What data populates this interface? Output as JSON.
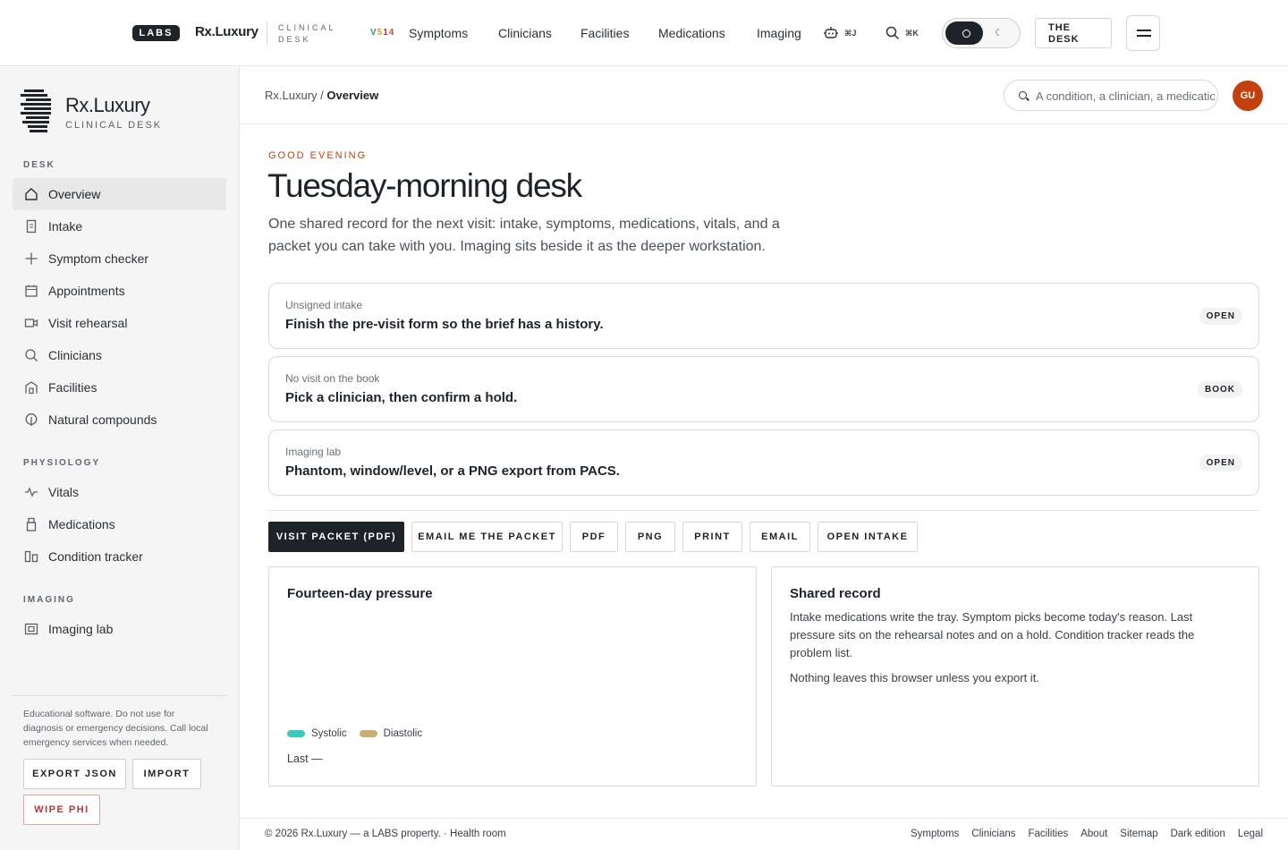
{
  "topbar": {
    "labs_badge": "LABS",
    "brand": "Rx.Luxury",
    "clinical_desk": "CLINICAL DESK",
    "version": {
      "v": "V",
      "d1": "5",
      "d2": "1",
      "d3": "4"
    },
    "nav": [
      "Symptoms",
      "Clinicians",
      "Facilities",
      "Medications",
      "Imaging"
    ],
    "assistant_shortcut": "⌘J",
    "search_shortcut": "⌘K",
    "desk_button": "THE DESK",
    "theme_mode": "light"
  },
  "sidebar": {
    "brand": "Rx.Luxury",
    "subtitle": "CLINICAL DESK",
    "sections": {
      "desk": "DESK",
      "physiology": "PHYSIOLOGY",
      "imaging": "IMAGING"
    },
    "desk_items": [
      {
        "label": "Overview",
        "icon": "home-icon"
      },
      {
        "label": "Intake",
        "icon": "document-icon"
      },
      {
        "label": "Symptom checker",
        "icon": "plus-icon"
      },
      {
        "label": "Appointments",
        "icon": "calendar-icon"
      },
      {
        "label": "Visit rehearsal",
        "icon": "video-icon"
      },
      {
        "label": "Clinicians",
        "icon": "search-icon"
      },
      {
        "label": "Facilities",
        "icon": "building-icon"
      },
      {
        "label": "Natural compounds",
        "icon": "leaf-icon"
      }
    ],
    "physiology_items": [
      {
        "label": "Vitals",
        "icon": "pulse-icon"
      },
      {
        "label": "Medications",
        "icon": "bottle-icon"
      },
      {
        "label": "Condition tracker",
        "icon": "columns-icon"
      }
    ],
    "imaging_items": [
      {
        "label": "Imaging lab",
        "icon": "image-icon"
      }
    ],
    "disclaimer": "Educational software. Do not use for diagnosis or emergency decisions. Call local emergency services when needed.",
    "export": "EXPORT JSON",
    "import": "IMPORT",
    "wipe": "WIPE PHI"
  },
  "header": {
    "crumb_root": "Rx.Luxury",
    "crumb_sep": "/",
    "crumb_current": "Overview",
    "search_placeholder": "A condition, a clinician, a medication",
    "avatar": "GU"
  },
  "main": {
    "greeting": "GOOD EVENING",
    "title": "Tuesday-morning desk",
    "lede": "One shared record for the next visit: intake, symptoms, medications, vitals, and a packet you can take with you. Imaging sits beside it as the deeper workstation.",
    "cards": [
      {
        "kicker": "Unsigned intake",
        "text": "Finish the pre-visit form so the brief has a history.",
        "badge": "OPEN"
      },
      {
        "kicker": "No visit on the book",
        "text": "Pick a clinician, then confirm a hold.",
        "badge": "BOOK"
      },
      {
        "kicker": "Imaging lab",
        "text": "Phantom, window/level, or a PNG export from PACS.",
        "badge": "OPEN"
      }
    ],
    "actions": [
      "VISIT PACKET (PDF)",
      "EMAIL ME THE PACKET",
      "PDF",
      "PNG",
      "PRINT",
      "EMAIL",
      "OPEN INTAKE"
    ],
    "pressure": {
      "title": "Fourteen-day pressure",
      "systolic": "Systolic",
      "diastolic": "Diastolic",
      "systolic_color": "#3cc9bd",
      "diastolic_color": "#c9ad72",
      "last": "Last —"
    },
    "shared": {
      "title": "Shared record",
      "p1": "Intake medications write the tray. Symptom picks become today's reason. Last pressure sits on the rehearsal notes and on a hold. Condition tracker reads the problem list.",
      "p2": "Nothing leaves this browser unless you export it."
    }
  },
  "footer": {
    "copyright": "© 2026 Rx.Luxury — a LABS property. · Health room",
    "links": [
      "Symptoms",
      "Clinicians",
      "Facilities",
      "About",
      "Sitemap",
      "Dark edition",
      "Legal"
    ]
  }
}
